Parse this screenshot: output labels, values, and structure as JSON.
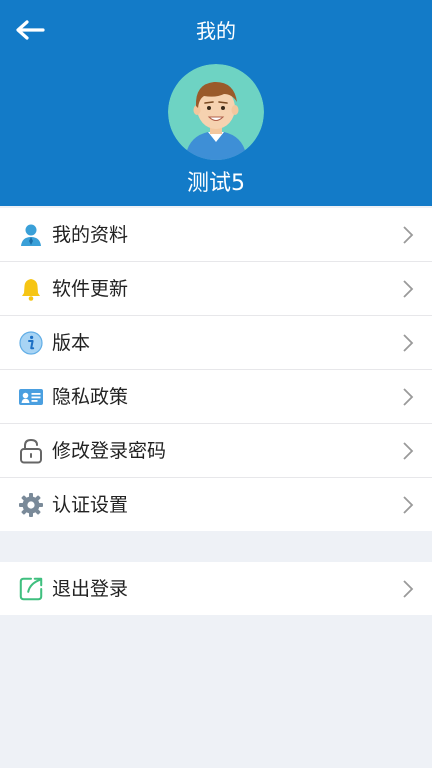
{
  "header": {
    "title": "我的",
    "username": "测试5"
  },
  "menu": {
    "items": [
      {
        "label": "我的资料",
        "icon": "user-profile-icon"
      },
      {
        "label": "软件更新",
        "icon": "bell-icon"
      },
      {
        "label": "版本",
        "icon": "info-icon"
      },
      {
        "label": "隐私政策",
        "icon": "id-card-icon"
      },
      {
        "label": "修改登录密码",
        "icon": "lock-icon"
      },
      {
        "label": "认证设置",
        "icon": "gear-icon"
      }
    ]
  },
  "logout": {
    "label": "退出登录",
    "icon": "exit-icon"
  },
  "colors": {
    "header_bg": "#137bc8",
    "page_bg": "#eef1f6",
    "accent_green": "#3fbf7f"
  }
}
